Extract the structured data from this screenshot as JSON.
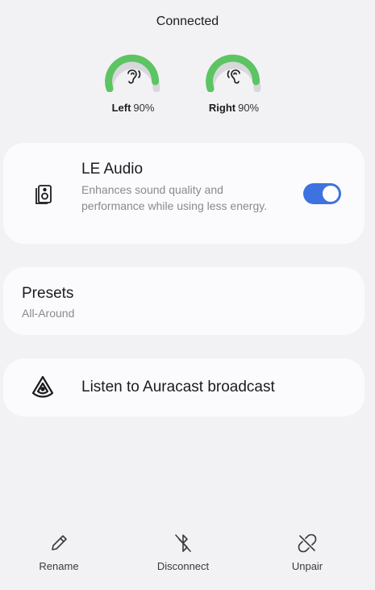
{
  "status": "Connected",
  "battery": {
    "left": {
      "label": "Left",
      "percent_text": "90%",
      "level": 0.9,
      "color": "#5cc462"
    },
    "right": {
      "label": "Right",
      "percent_text": "90%",
      "level": 0.9,
      "color": "#5cc462"
    }
  },
  "le_audio": {
    "title": "LE Audio",
    "description": "Enhances sound quality and performance while using less energy.",
    "enabled": true,
    "icon": "speaker-icon",
    "toggle_color": "#3e72e0"
  },
  "presets": {
    "title": "Presets",
    "value": "All-Around"
  },
  "auracast": {
    "label": "Listen to Auracast broadcast",
    "icon": "auracast-icon"
  },
  "actions": {
    "rename": "Rename",
    "disconnect": "Disconnect",
    "unpair": "Unpair"
  }
}
